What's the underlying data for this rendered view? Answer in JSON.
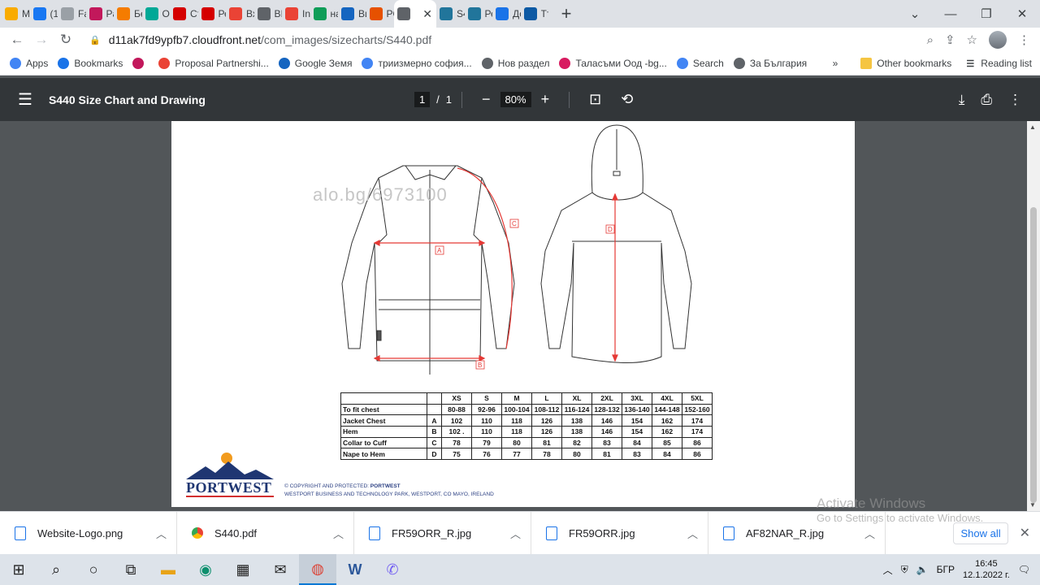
{
  "tabs": [
    {
      "title": "Ma",
      "icon": "flag-icon",
      "color": "#f9ab00"
    },
    {
      "title": "(1)",
      "icon": "facebook-icon",
      "color": "#1877f2"
    },
    {
      "title": "Fac",
      "icon": "loading-icon",
      "color": "#9aa0a6"
    },
    {
      "title": "Pag",
      "icon": "play-icon",
      "color": "#c2185b"
    },
    {
      "title": "Бе",
      "icon": "flame-icon",
      "color": "#f57c00"
    },
    {
      "title": "Об",
      "icon": "ok-icon",
      "color": "#00a896"
    },
    {
      "title": "Съ",
      "icon": "alo-icon",
      "color": "#d50000"
    },
    {
      "title": "Ре",
      "icon": "alo-icon",
      "color": "#d50000"
    },
    {
      "title": "Вх",
      "icon": "gmail-icon",
      "color": "#ea4335"
    },
    {
      "title": "BIZ",
      "icon": "globe-icon",
      "color": "#5f6368"
    },
    {
      "title": "Inb",
      "icon": "gmail-icon",
      "color": "#ea4335"
    },
    {
      "title": "на",
      "icon": "sheets-icon",
      "color": "#0f9d58"
    },
    {
      "title": "Ви",
      "icon": "p-icon",
      "color": "#1565c0"
    },
    {
      "title": "PO",
      "icon": "a-icon",
      "color": "#e65100"
    },
    {
      "title": "",
      "icon": "globe-icon",
      "color": "#5f6368",
      "active": true
    },
    {
      "title": "S4",
      "icon": "wordpress-icon",
      "color": "#21759b"
    },
    {
      "title": "Ре",
      "icon": "wordpress-icon",
      "color": "#21759b"
    },
    {
      "title": "До",
      "icon": "doc-icon",
      "color": "#1a73e8"
    },
    {
      "title": "Тъ",
      "icon": "edge-icon",
      "color": "#0c59a4"
    }
  ],
  "url": {
    "host": "d11ak7fd9ypfb7.cloudfront.net",
    "path": "/com_images/sizecharts/S440.pdf"
  },
  "bookmarks": [
    {
      "label": "Apps",
      "icon": "apps-icon"
    },
    {
      "label": "Bookmarks",
      "icon": "star-icon"
    },
    {
      "label": "",
      "icon": "me-icon"
    },
    {
      "label": "Proposal Partnershi...",
      "icon": "gmail-icon"
    },
    {
      "label": "Google Земя",
      "icon": "earth-icon"
    },
    {
      "label": "триизмерно софия...",
      "icon": "google-icon"
    },
    {
      "label": "Нов раздел",
      "icon": "globe-icon"
    },
    {
      "label": "Таласъми Оод -bg...",
      "icon": "seven-icon"
    },
    {
      "label": "Search",
      "icon": "google-icon"
    },
    {
      "label": "За България",
      "icon": "globe-icon"
    }
  ],
  "bookmarks_more": "»",
  "other_bookmarks": "Other bookmarks",
  "reading_list": "Reading list",
  "pdf": {
    "title": "S440 Size Chart and Drawing",
    "page_current": "1",
    "page_total": "1",
    "page_sep": "/",
    "zoom": "80%"
  },
  "document": {
    "watermark": "alo.bg/6973100",
    "labels": {
      "a": "A",
      "b": "B",
      "c": "C",
      "d": "D"
    },
    "size_table": {
      "headers": [
        "",
        "",
        "XS",
        "S",
        "M",
        "L",
        "XL",
        "2XL",
        "3XL",
        "4XL",
        "5XL"
      ],
      "rows": [
        {
          "label": "To fit chest",
          "mark": "",
          "values": [
            "80-88",
            "92-96",
            "100-104",
            "108-112",
            "116-124",
            "128-132",
            "136-140",
            "144-148",
            "152-160"
          ]
        },
        {
          "label": "Jacket Chest",
          "mark": "A",
          "values": [
            "102",
            "110",
            "118",
            "126",
            "138",
            "146",
            "154",
            "162",
            "174"
          ]
        },
        {
          "label": "Hem",
          "mark": "B",
          "values": [
            "102 .",
            "110",
            "118",
            "126",
            "138",
            "146",
            "154",
            "162",
            "174"
          ]
        },
        {
          "label": "Collar to Cuff",
          "mark": "C",
          "values": [
            "78",
            "79",
            "80",
            "81",
            "82",
            "83",
            "84",
            "85",
            "86"
          ]
        },
        {
          "label": "Nape to Hem",
          "mark": "D",
          "values": [
            "75",
            "76",
            "77",
            "78",
            "80",
            "81",
            "83",
            "84",
            "86"
          ]
        }
      ]
    },
    "logo_text": "PORTWEST",
    "copyright_line1_prefix": "© COPYRIGHT AND PROTECTED: ",
    "copyright_line1_brand": "PORTWEST",
    "copyright_line2": "WESTPORT BUSINESS AND TECHNOLOGY PARK, WESTPORT, CO MAYO, IRELAND"
  },
  "activate": {
    "line1": "Activate Windows",
    "line2": "Go to Settings to activate Windows."
  },
  "downloads": [
    {
      "name": "Website-Logo.png",
      "icon": "image-file-icon"
    },
    {
      "name": "S440.pdf",
      "icon": "chrome-icon"
    },
    {
      "name": "FR59ORR_R.jpg",
      "icon": "image-file-icon"
    },
    {
      "name": "FR59ORR.jpg",
      "icon": "image-file-icon"
    },
    {
      "name": "AF82NAR_R.jpg",
      "icon": "image-file-icon"
    }
  ],
  "show_all": "Show all",
  "taskbar": {
    "lang": "БГР",
    "time": "16:45",
    "date": "12.1.2022 г."
  },
  "colors": {
    "accent": "#1a73e8",
    "measure": "#e53935",
    "brand": "#1f3672"
  }
}
